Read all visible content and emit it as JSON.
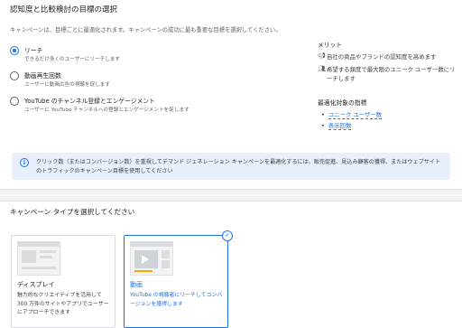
{
  "goal_section": {
    "title": "認知度と比較検討の目標の選択",
    "description": "キャンペーンは、目標ごとに最適化されます。キャンペーンの成功に最も重要な目標を選択してください。",
    "options": [
      {
        "label": "リーチ",
        "sub": "できるだけ多くのユーザーにリーチします",
        "selected": true
      },
      {
        "label": "動画再生回数",
        "sub": "ユーザーに動画広告の視聴を促します",
        "selected": false
      },
      {
        "label": "YouTube のチャンネル登録とエンゲージメント",
        "sub": "ユーザーに YouTube チャンネルへの登録とエンゲージメントを促します",
        "selected": false
      }
    ]
  },
  "side_panel": {
    "merit_heading": "メリット",
    "merits": [
      {
        "icon": "megaphone-icon",
        "text": "自社の商品やブランドの認知度を高めます"
      },
      {
        "icon": "people-icon",
        "text": "希望する頻度で最大限のユニーク ユーザー数にリーチします"
      }
    ],
    "metric_heading": "最適化対象の指標",
    "metrics": [
      "ユニーク ユーザー数",
      "表示回数"
    ]
  },
  "info_banner": {
    "icon": "info-icon",
    "text": "クリック数（またはコンバージョン数）を重視してデマンド ジェネレーション キャンペーンを最適化するには、販売促進、見込み顧客の獲得、またはウェブサイトのトラフィックのキャンペーン目標を使用してください"
  },
  "type_section": {
    "title": "キャンペーン タイプを選択してください",
    "cards": [
      {
        "name": "ディスプレイ",
        "desc": "魅力的なクリエイティブを活用して 300 万件のサイトやアプリでユーザーにアプローチできます",
        "selected": false
      },
      {
        "name": "動画",
        "desc": "YouTube の視聴者にリーチしてコンバージョンを獲得します",
        "selected": true
      }
    ]
  },
  "colors": {
    "accent": "#1a73e8",
    "info_bg": "#e8f0fe",
    "text": "#202124",
    "muted": "#5f6368"
  }
}
